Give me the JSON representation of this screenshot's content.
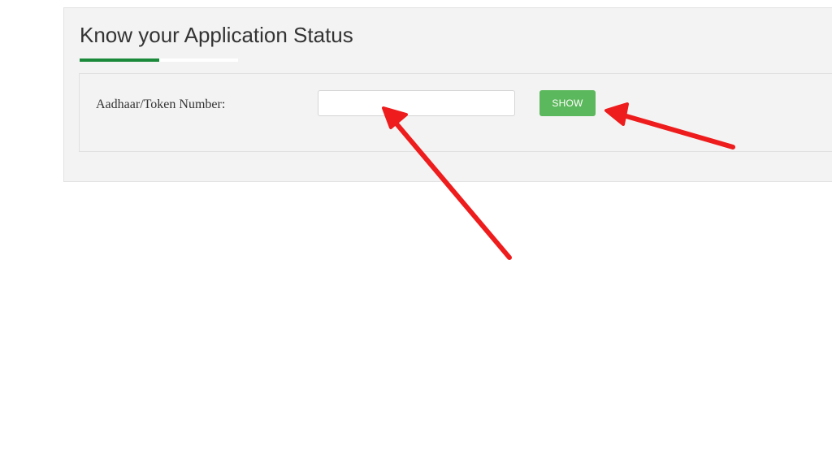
{
  "panel": {
    "title": "Know your Application Status"
  },
  "form": {
    "label": "Aadhaar/Token Number:",
    "input_value": "",
    "input_placeholder": "",
    "show_button_label": "SHOW"
  },
  "colors": {
    "accent_green": "#1a8a3a",
    "button_green": "#5cb85c",
    "arrow_red": "#ee1c1c"
  }
}
